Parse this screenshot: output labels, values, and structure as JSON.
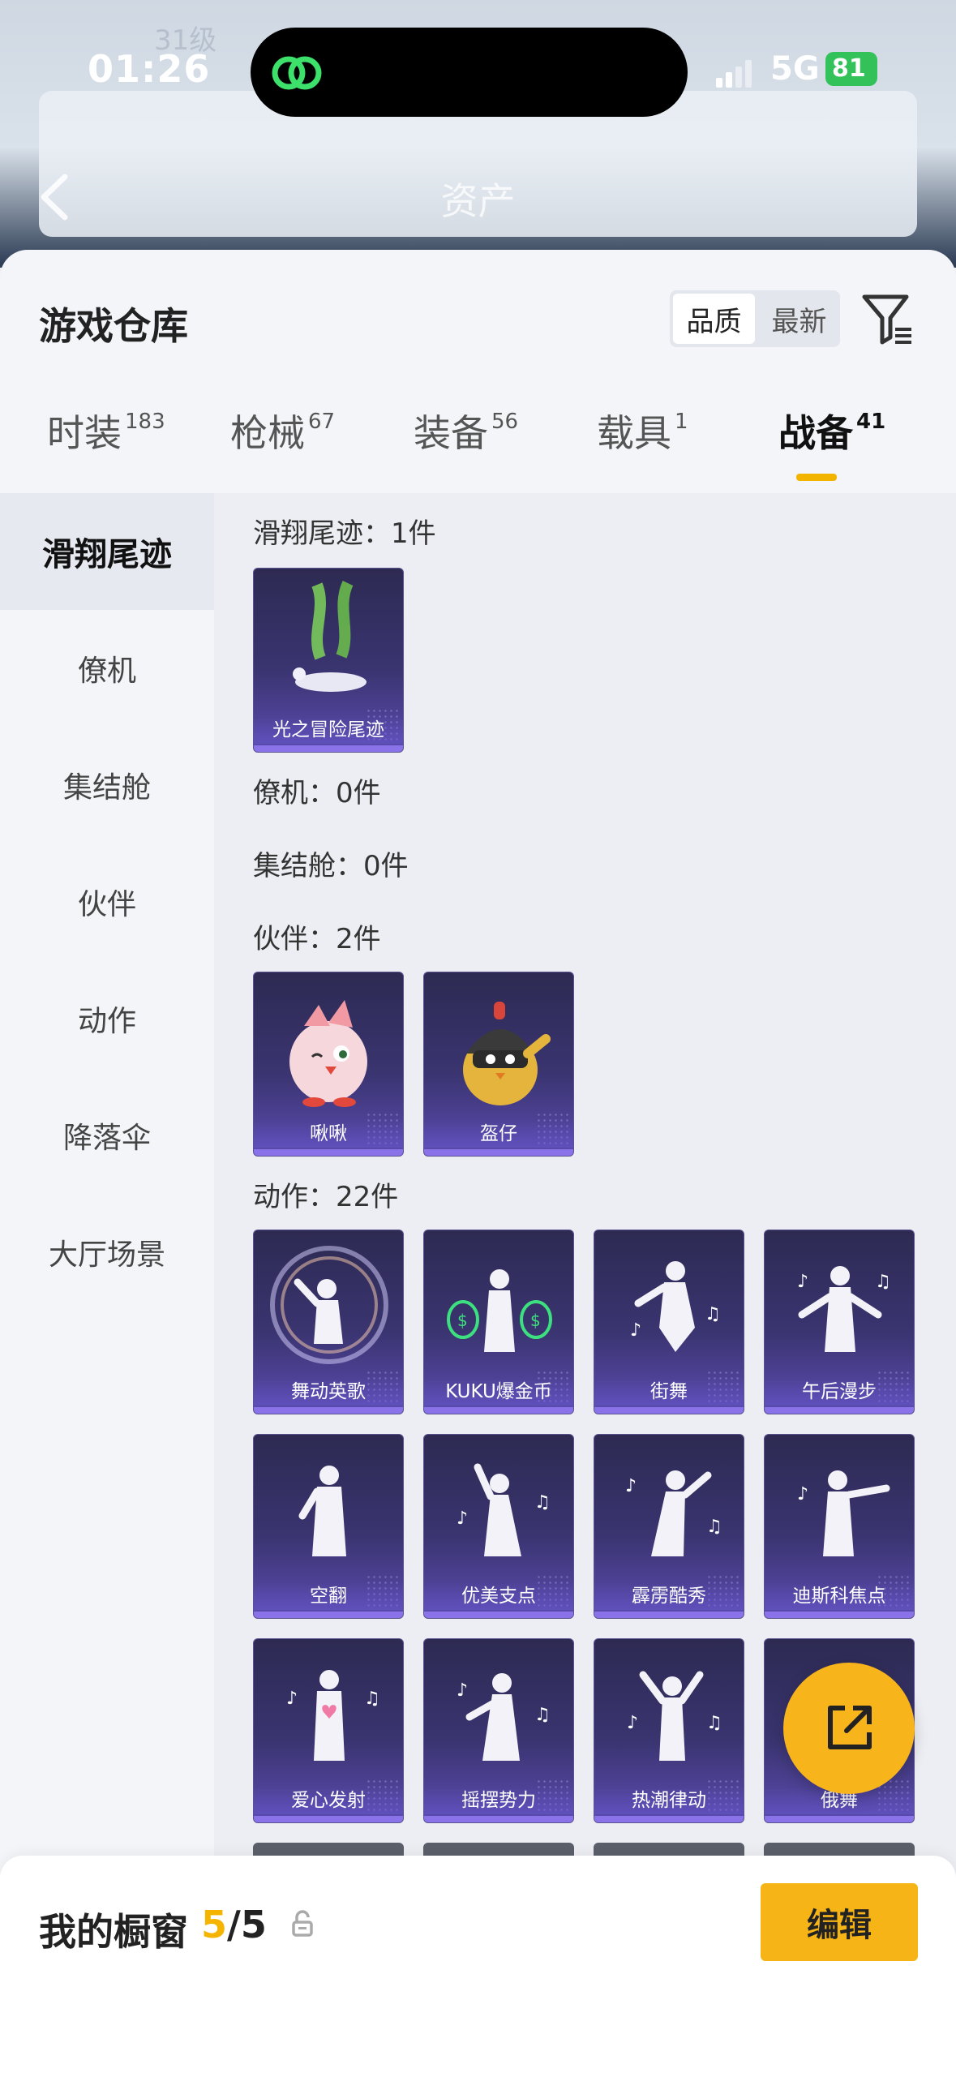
{
  "status": {
    "time": "01:26",
    "network": "5G",
    "battery": "81"
  },
  "header": {
    "title": "资产",
    "ghost_level": "31级"
  },
  "sheet": {
    "title": "游戏仓库",
    "sort": {
      "quality": "品质",
      "newest": "最新"
    }
  },
  "tabs": [
    {
      "label": "时装",
      "count": "183"
    },
    {
      "label": "枪械",
      "count": "67"
    },
    {
      "label": "装备",
      "count": "56"
    },
    {
      "label": "载具",
      "count": "1"
    },
    {
      "label": "战备",
      "count": "41"
    }
  ],
  "sidenav": [
    "滑翔尾迹",
    "僚机",
    "集结舱",
    "伙伴",
    "动作",
    "降落伞",
    "大厅场景"
  ],
  "sections": {
    "glide": {
      "title": "滑翔尾迹：1件",
      "items": [
        "光之冒险尾迹"
      ]
    },
    "wingman": {
      "title": "僚机：0件"
    },
    "pod": {
      "title": "集结舱：0件"
    },
    "partner": {
      "title": "伙伴：2件",
      "items": [
        "啾啾",
        "盔仔"
      ]
    },
    "emote": {
      "title": "动作：22件",
      "items": [
        "舞动英歌",
        "KUKU爆金币",
        "街舞",
        "午后漫步",
        "空翻",
        "优美支点",
        "霹雳酷秀",
        "迪斯科焦点",
        "爱心发射",
        "摇摆势力",
        "热潮律动",
        "俄舞"
      ]
    }
  },
  "bottom": {
    "title": "我的橱窗",
    "count_current": "5",
    "count_total": "/5",
    "edit_label": "编辑"
  },
  "colors": {
    "accent": "#f6b417",
    "card": "#3a3470",
    "active_tab_underline": "#f3b400"
  },
  "icons": [
    "back-icon",
    "filter-icon",
    "lock-icon",
    "share-icon",
    "app-island-icon"
  ]
}
